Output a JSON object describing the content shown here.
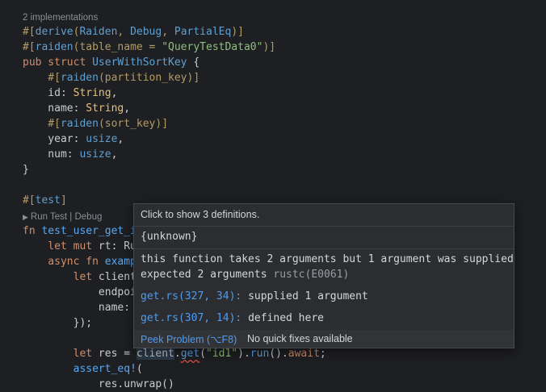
{
  "codelens": {
    "implementations": "2 implementations",
    "run_test": "Run Test | Debug"
  },
  "code": {
    "l1_a": "#[",
    "l1_b": "derive",
    "l1_c": "(",
    "l1_d": "Raiden",
    "l1_e": ", ",
    "l1_f": "Debug",
    "l1_g": ", ",
    "l1_h": "PartialEq",
    "l1_i": ")]",
    "l2_a": "#[",
    "l2_b": "raiden",
    "l2_c": "(table_name = ",
    "l2_d": "\"QueryTestData0\"",
    "l2_e": ")]",
    "l3_a": "pub struct ",
    "l3_b": "UserWithSortKey",
    "l3_c": " {",
    "l4_a": "    #[",
    "l4_b": "raiden",
    "l4_c": "(partition_key)]",
    "l5_a": "    id: ",
    "l5_b": "String",
    "l5_c": ",",
    "l6_a": "    name: ",
    "l6_b": "String",
    "l6_c": ",",
    "l7_a": "    #[",
    "l7_b": "raiden",
    "l7_c": "(sort_key)]",
    "l8_a": "    year: ",
    "l8_b": "usize",
    "l8_c": ",",
    "l9_a": "    num: ",
    "l9_b": "usize",
    "l9_c": ",",
    "l10": "}",
    "l11_a": "#[",
    "l11_b": "test",
    "l11_c": "]",
    "l12_a": "fn ",
    "l12_b": "test_user_get_i",
    "l13_a": "    let mut ",
    "l13_b": "rt: Ru",
    "l14_a": "    async fn ",
    "l14_b": "examp",
    "l15_a": "        let ",
    "l15_b": "client",
    "l16": "            endpoi",
    "l17": "            name:",
    "l18": "        });",
    "l19_a": "        let ",
    "l19_b": "res",
    "l19_c": " = ",
    "l19_d": "client",
    "l19_e": ".",
    "l19_f": "get",
    "l19_g": "(",
    "l19_h": "\"id1\"",
    "l19_i": ").",
    "l19_j": "run",
    "l19_k": "().",
    "l19_l": "await",
    "l19_m": ";",
    "l20_a": "        ",
    "l20_b": "assert_eq!",
    "l20_c": "(",
    "l21": "            res.unwrap()"
  },
  "hover": {
    "header": "Click to show 3 definitions.",
    "type": "{unknown}",
    "message1": "this function takes 2 arguments but 1 argument was supplied",
    "message2": "expected 2 arguments",
    "code": "rustc(E0061)",
    "ref1_link": "get.rs(327, 34):",
    "ref1_text": "supplied 1 argument",
    "ref2_link": "get.rs(307, 14):",
    "ref2_text": "defined here",
    "peek_problem": "Peek Problem (⌥F8)",
    "no_fixes": "No quick fixes available"
  },
  "colors": {
    "background": "#1e1f22",
    "keyword": "#cf8e6d",
    "type": "#5fa0d0",
    "string": "#8fbf7f",
    "link": "#4f9cf0",
    "error": "#d64b4b"
  }
}
